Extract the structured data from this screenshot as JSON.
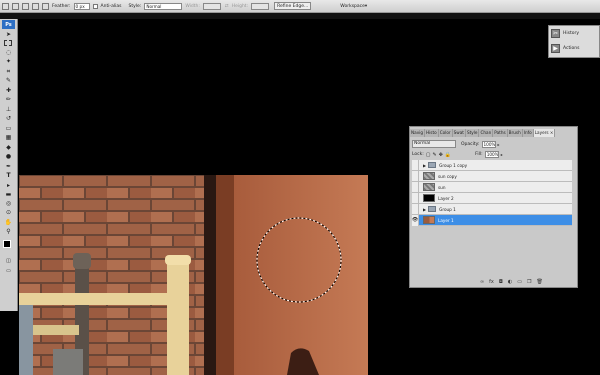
{
  "options_bar": {
    "feather_label": "Feather:",
    "feather_value": "0 px",
    "antialias_label": "Anti-alias",
    "style_label": "Style:",
    "style_value": "Normal",
    "width_label": "Width:",
    "height_label": "Height:",
    "refine_edge": "Refine Edge...",
    "workspace": "Workspace"
  },
  "tools": {
    "logo": "Ps"
  },
  "mini_panel": {
    "history": "History",
    "actions": "Actions"
  },
  "layers_panel": {
    "tabs": [
      "Navig",
      "Histo",
      "Color",
      "Swat",
      "Style",
      "Chan",
      "Paths",
      "Brush",
      "Info",
      "Layers"
    ],
    "close": "×",
    "blend_mode": "Normal",
    "opacity_label": "Opacity:",
    "opacity_value": "100%",
    "lock_label": "Lock:",
    "fill_label": "Fill:",
    "fill_value": "100%",
    "layers": [
      {
        "name": "Group 1 copy",
        "type": "group",
        "visible": false,
        "selected": false
      },
      {
        "name": "sun copy",
        "type": "pattern",
        "visible": false,
        "selected": false
      },
      {
        "name": "sun",
        "type": "pattern",
        "visible": false,
        "selected": false
      },
      {
        "name": "Layer 2",
        "type": "black",
        "visible": false,
        "selected": false
      },
      {
        "name": "Group 1",
        "type": "group",
        "visible": false,
        "selected": false
      },
      {
        "name": "Layer 1",
        "type": "image",
        "visible": true,
        "selected": true
      }
    ]
  },
  "colors": {
    "brick": "#9a5b3e",
    "wall": "#b8704e",
    "selection": "#3d8ee6"
  }
}
